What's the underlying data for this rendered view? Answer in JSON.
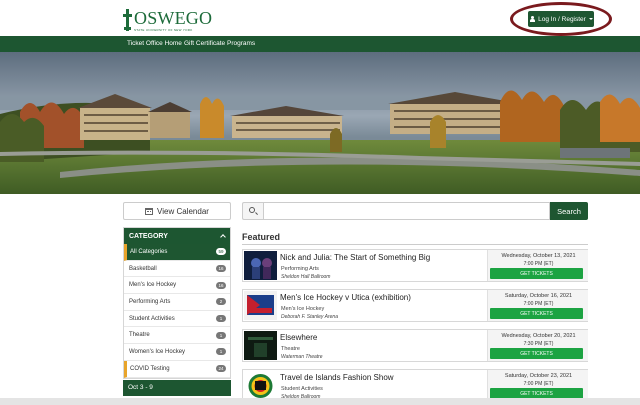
{
  "header": {
    "logo_text": "OSWEGO",
    "logo_sub": "STATE UNIVERSITY OF NEW YORK",
    "login_label": "Log In / Register"
  },
  "nav": {
    "items": [
      {
        "label": "Ticket Office Home"
      },
      {
        "label": "Gift Certificate Programs"
      }
    ]
  },
  "toolbar": {
    "view_calendar_label": "View Calendar",
    "search_placeholder": "",
    "search_button_label": "Search"
  },
  "category": {
    "header_label": "CATEGORY",
    "items": [
      {
        "label": "All Categories",
        "count": "59"
      },
      {
        "label": "Basketball",
        "count": "16"
      },
      {
        "label": "Men's Ice Hockey",
        "count": "16"
      },
      {
        "label": "Performing Arts",
        "count": "2"
      },
      {
        "label": "Student Activities",
        "count": "1"
      },
      {
        "label": "Theatre",
        "count": "1"
      },
      {
        "label": "Women's Ice Hockey",
        "count": "1"
      },
      {
        "label": "COVID Testing",
        "count": "24"
      }
    ]
  },
  "date_filter": {
    "label": "Oct 3 - 9"
  },
  "featured": {
    "title": "Featured",
    "events": [
      {
        "title": "Nick and Julia: The Start of Something Big",
        "category": "Performing Arts",
        "location": "Sheldon Hall Ballroom",
        "date": "Wednesday, October 13, 2021",
        "time": "7:00 PM (ET)",
        "button": "GET TICKETS"
      },
      {
        "title": "Men's Ice Hockey v Utica (exhibition)",
        "category": "Men's Ice Hockey",
        "location": "Deborah F. Stanley Arena",
        "date": "Saturday, October 16, 2021",
        "time": "7:00 PM (ET)",
        "button": "GET TICKETS"
      },
      {
        "title": "Elsewhere",
        "category": "Theatre",
        "location": "Waterman Theatre",
        "date": "Wednesday, October 20, 2021",
        "time": "7:30 PM (ET)",
        "button": "GET TICKETS"
      },
      {
        "title": "Travel de Islands Fashion Show",
        "category": "Student Activities",
        "location": "Sheldon Ballroom",
        "date": "Saturday, October 23, 2021",
        "time": "7:00 PM (ET)",
        "button": "GET TICKETS"
      }
    ]
  },
  "colors": {
    "brand_green": "#1d5631",
    "ticket_green": "#1ca342",
    "annotation_ring": "#7a1a1e"
  }
}
